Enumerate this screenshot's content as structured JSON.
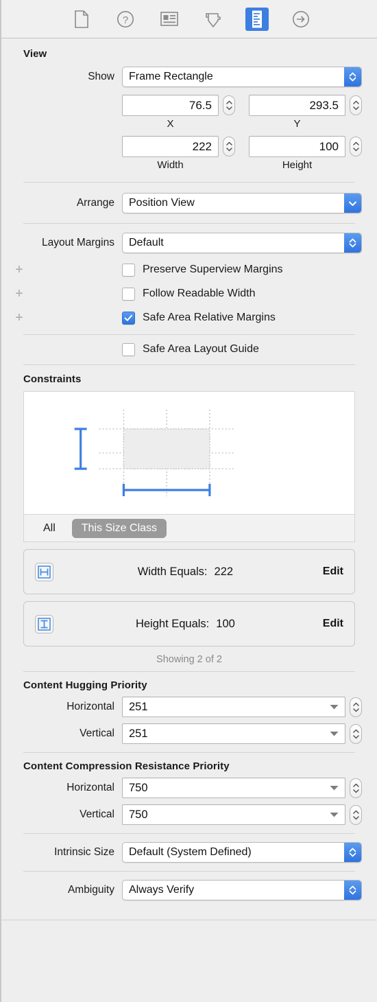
{
  "toolbar": {
    "items": [
      {
        "name": "file-inspector-icon",
        "label": "File Inspector",
        "selected": false
      },
      {
        "name": "quick-help-inspector-icon",
        "label": "Quick Help Inspector",
        "selected": false
      },
      {
        "name": "identity-inspector-icon",
        "label": "Identity Inspector",
        "selected": false
      },
      {
        "name": "attributes-inspector-icon",
        "label": "Attributes Inspector",
        "selected": false
      },
      {
        "name": "size-inspector-icon",
        "label": "Size Inspector",
        "selected": true
      },
      {
        "name": "connections-inspector-icon",
        "label": "Connections Inspector",
        "selected": false
      }
    ],
    "selected_color": "#3d7fe0"
  },
  "view_section": {
    "title": "View",
    "show": {
      "label": "Show",
      "value": "Frame Rectangle"
    },
    "fields": [
      {
        "name": "x",
        "value": "76.5",
        "caption": "X"
      },
      {
        "name": "y",
        "value": "293.5",
        "caption": "Y"
      },
      {
        "name": "width",
        "value": "222",
        "caption": "Width"
      },
      {
        "name": "height",
        "value": "100",
        "caption": "Height"
      }
    ],
    "arrange": {
      "label": "Arrange",
      "value": "Position View"
    },
    "layout_margins": {
      "label": "Layout Margins",
      "value": "Default"
    },
    "checkboxes": [
      {
        "label": "Preserve Superview Margins",
        "checked": false,
        "has_plus": true
      },
      {
        "label": "Follow Readable Width",
        "checked": false,
        "has_plus": true
      },
      {
        "label": "Safe Area Relative Margins",
        "checked": true,
        "has_plus": true
      },
      {
        "label": "Safe Area Layout Guide",
        "checked": false,
        "has_plus": false
      }
    ]
  },
  "constraints_section": {
    "title": "Constraints",
    "segments": [
      {
        "label": "All",
        "selected": false
      },
      {
        "label": "This Size Class",
        "selected": true
      }
    ],
    "rows": [
      {
        "icon": "width-constraint-icon",
        "text": "Width Equals:",
        "value": "222",
        "edit": "Edit"
      },
      {
        "icon": "height-constraint-icon",
        "text": "Height Equals:",
        "value": "100",
        "edit": "Edit"
      }
    ],
    "showing": "Showing 2 of 2",
    "accent": "#3d7fe0"
  },
  "hugging_section": {
    "title": "Content Hugging Priority",
    "horizontal": {
      "label": "Horizontal",
      "value": "251"
    },
    "vertical": {
      "label": "Vertical",
      "value": "251"
    }
  },
  "compression_section": {
    "title": "Content Compression Resistance Priority",
    "horizontal": {
      "label": "Horizontal",
      "value": "750"
    },
    "vertical": {
      "label": "Vertical",
      "value": "750"
    }
  },
  "intrinsic": {
    "label": "Intrinsic Size",
    "value": "Default (System Defined)"
  },
  "ambiguity": {
    "label": "Ambiguity",
    "value": "Always Verify"
  }
}
